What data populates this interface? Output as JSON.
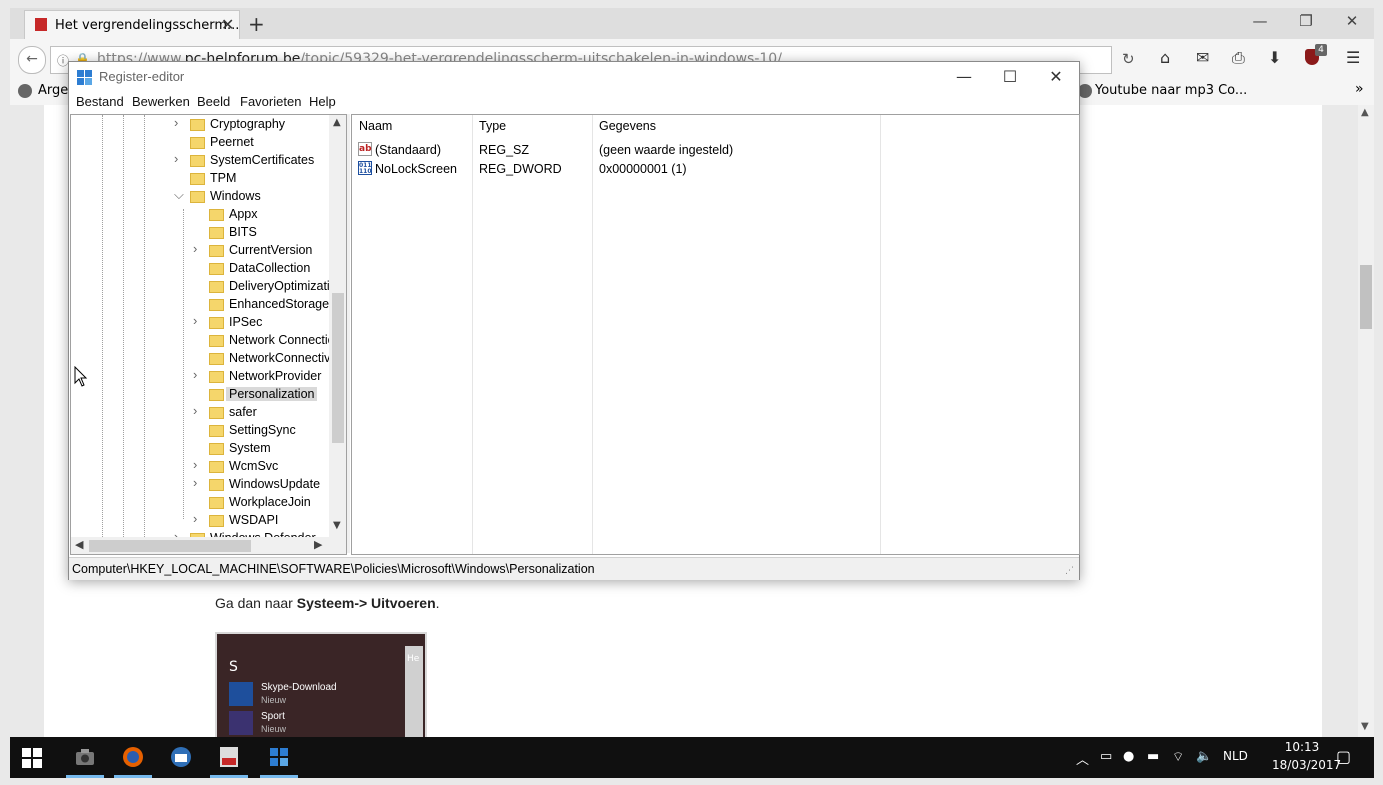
{
  "browser": {
    "tab_title": "Het vergrendelingsscherm...",
    "new_tab": "+",
    "url_prefix": "https://www.",
    "url_domain": "pc-helpforum.be",
    "url_path": "/topic/59329-het-vergrendelingsscherm-uitschakelen-in-windows-10/",
    "ublock_count": "4",
    "bookmark_left": "Arger",
    "bookmark_right": "Youtube naar mp3 Co...",
    "bookmarks_more": "»"
  },
  "article": {
    "text_prefix": "Ga dan naar ",
    "text_bold": "Systeem-> Uitvoeren",
    "text_suffix": ".",
    "start_menu": {
      "letter": "S",
      "items": [
        {
          "name": "Skype-Download",
          "sub": "Nieuw"
        },
        {
          "name": "Sport",
          "sub": "Nieuw"
        }
      ],
      "side_text": "He"
    }
  },
  "regedit": {
    "title": "Register-editor",
    "menu": [
      "Bestand",
      "Bewerken",
      "Beeld",
      "Favorieten",
      "Help"
    ],
    "tree": [
      {
        "label": "Cryptography",
        "level": 0,
        "expander": "right"
      },
      {
        "label": "Peernet",
        "level": 0,
        "expander": "none"
      },
      {
        "label": "SystemCertificates",
        "level": 0,
        "expander": "right"
      },
      {
        "label": "TPM",
        "level": 0,
        "expander": "none"
      },
      {
        "label": "Windows",
        "level": 0,
        "expander": "down"
      },
      {
        "label": "Appx",
        "level": 1,
        "expander": "none"
      },
      {
        "label": "BITS",
        "level": 1,
        "expander": "none"
      },
      {
        "label": "CurrentVersion",
        "level": 1,
        "expander": "right"
      },
      {
        "label": "DataCollection",
        "level": 1,
        "expander": "none"
      },
      {
        "label": "DeliveryOptimizati",
        "level": 1,
        "expander": "none"
      },
      {
        "label": "EnhancedStorageD",
        "level": 1,
        "expander": "none"
      },
      {
        "label": "IPSec",
        "level": 1,
        "expander": "right"
      },
      {
        "label": "Network Connectio",
        "level": 1,
        "expander": "none"
      },
      {
        "label": "NetworkConnectiv",
        "level": 1,
        "expander": "none"
      },
      {
        "label": "NetworkProvider",
        "level": 1,
        "expander": "right"
      },
      {
        "label": "Personalization",
        "level": 1,
        "expander": "none",
        "selected": true
      },
      {
        "label": "safer",
        "level": 1,
        "expander": "right"
      },
      {
        "label": "SettingSync",
        "level": 1,
        "expander": "none"
      },
      {
        "label": "System",
        "level": 1,
        "expander": "none"
      },
      {
        "label": "WcmSvc",
        "level": 1,
        "expander": "right"
      },
      {
        "label": "WindowsUpdate",
        "level": 1,
        "expander": "right"
      },
      {
        "label": "WorkplaceJoin",
        "level": 1,
        "expander": "none"
      },
      {
        "label": "WSDAPI",
        "level": 1,
        "expander": "right"
      },
      {
        "label": "Windows Defender",
        "level": 0,
        "expander": "right"
      }
    ],
    "columns": [
      "Naam",
      "Type",
      "Gegevens"
    ],
    "values": [
      {
        "icon": "string-value-icon",
        "icon_text": "ab",
        "name": "(Standaard)",
        "type": "REG_SZ",
        "data": "(geen waarde ingesteld)"
      },
      {
        "icon": "dword-value-icon",
        "icon_text": "011 110",
        "name": "NoLockScreen",
        "type": "REG_DWORD",
        "data": "0x00000001 (1)"
      }
    ],
    "status_path": "Computer\\HKEY_LOCAL_MACHINE\\SOFTWARE\\Policies\\Microsoft\\Windows\\Personalization"
  },
  "taskbar": {
    "language": "NLD",
    "time": "10:13",
    "date": "18/03/2017",
    "apps": [
      "camera-app-icon",
      "firefox-icon",
      "thunderbird-icon",
      "pdf-app-icon",
      "regedit-icon"
    ]
  },
  "colors": {
    "taskbar_bg": "#101010",
    "taskbar_indicator": "#76b9ed",
    "tree_selection": "#d9d9d9",
    "folder": "#f5d66b",
    "tab_favicon": "#c62828"
  }
}
